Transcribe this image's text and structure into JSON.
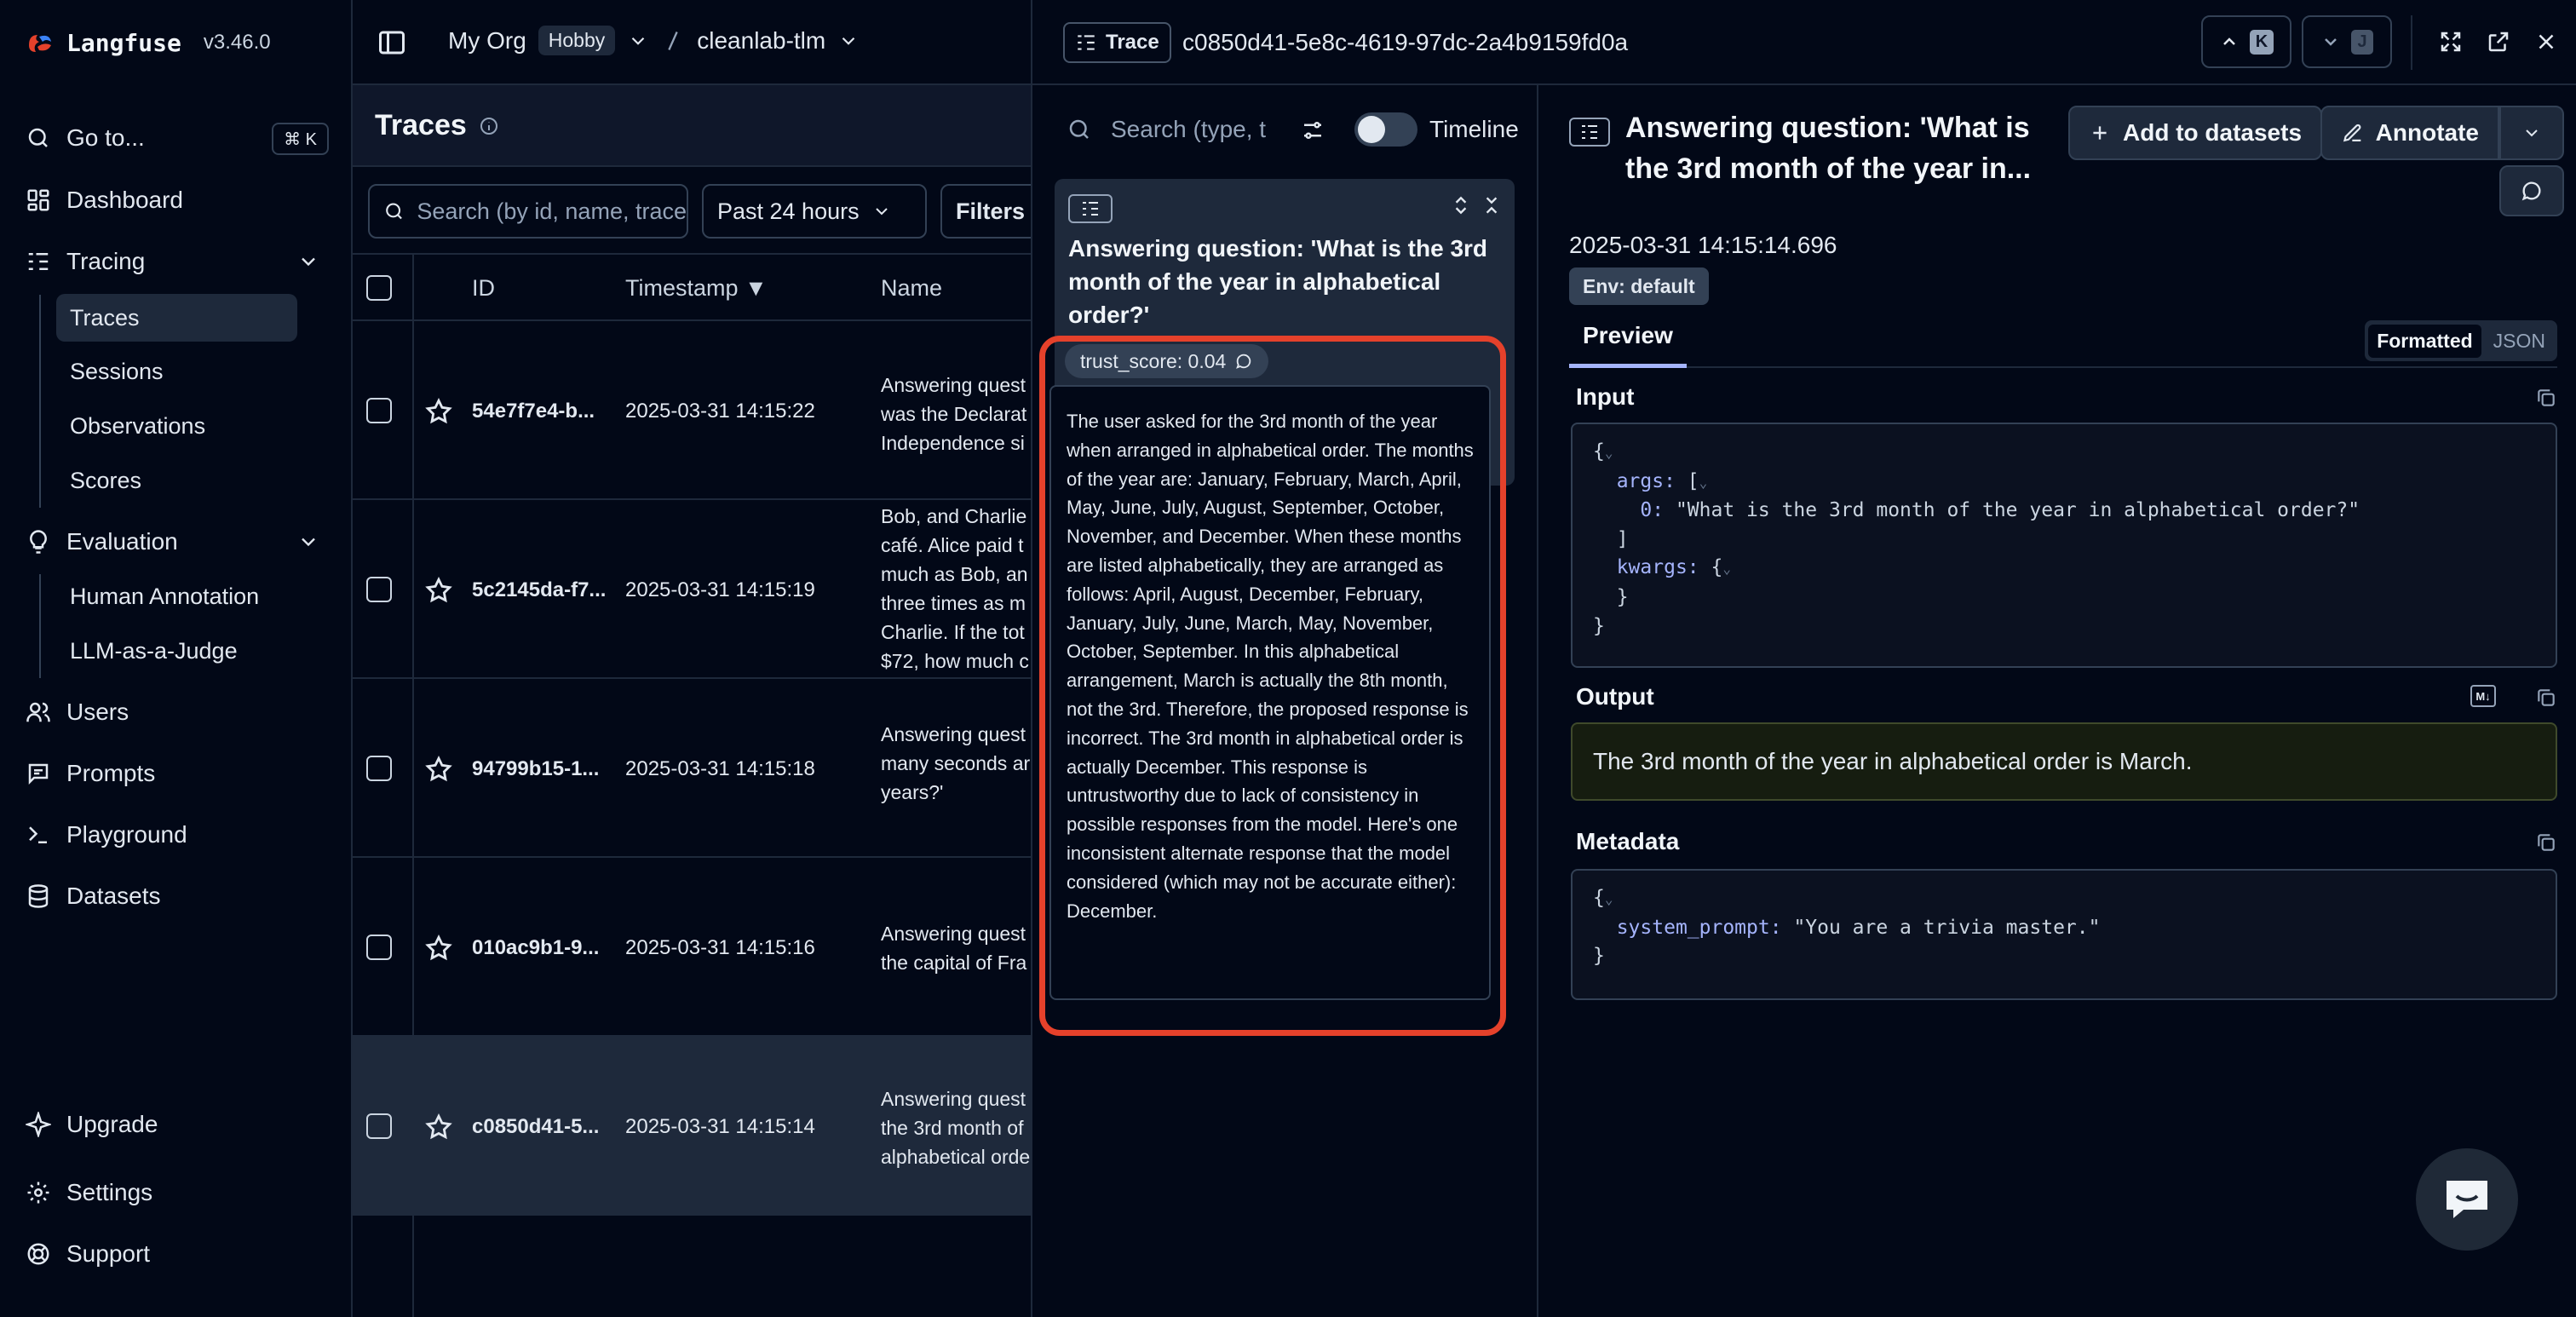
{
  "app": {
    "name": "Langfuse",
    "version": "v3.46.0"
  },
  "sidebar": {
    "goto": {
      "label": "Go to...",
      "shortcut": "⌘ K"
    },
    "items": [
      {
        "label": "Dashboard",
        "icon": "dashboard-icon"
      },
      {
        "label": "Tracing",
        "icon": "tracing-icon"
      },
      {
        "label": "Evaluation",
        "icon": "lightbulb-icon"
      },
      {
        "label": "Users",
        "icon": "users-icon"
      },
      {
        "label": "Prompts",
        "icon": "prompts-icon"
      },
      {
        "label": "Playground",
        "icon": "terminal-icon"
      },
      {
        "label": "Datasets",
        "icon": "database-icon"
      }
    ],
    "tracing_sub": [
      "Traces",
      "Sessions",
      "Observations",
      "Scores"
    ],
    "evaluation_sub": [
      "Human Annotation",
      "LLM-as-a-Judge"
    ],
    "bottom": [
      {
        "label": "Upgrade",
        "icon": "sparkle-icon"
      },
      {
        "label": "Settings",
        "icon": "settings-icon"
      },
      {
        "label": "Support",
        "icon": "lifebuoy-icon"
      }
    ]
  },
  "topbar": {
    "org": "My Org",
    "plan": "Hobby",
    "project": "cleanlab-tlm"
  },
  "traces": {
    "title": "Traces",
    "search_placeholder": "Search (by id, name, trace",
    "range": "Past 24 hours",
    "filters": "Filters",
    "columns": {
      "id": "ID",
      "timestamp": "Timestamp ▼",
      "name": "Name"
    },
    "rows": [
      {
        "id": "54e7f7e4-b...",
        "timestamp": "2025-03-31 14:15:22",
        "name": [
          "Answering quest",
          "was the Declarat",
          "Independence si"
        ]
      },
      {
        "id": "5c2145da-f7...",
        "timestamp": "2025-03-31 14:15:19",
        "name": [
          "Bob, and Charlie",
          "café. Alice paid t",
          "much as Bob, an",
          "three times as m",
          "Charlie. If the tot",
          "$72, how much c"
        ]
      },
      {
        "id": "94799b15-1...",
        "timestamp": "2025-03-31 14:15:18",
        "name": [
          "Answering quest",
          "many seconds ar",
          "years?'"
        ]
      },
      {
        "id": "010ac9b1-9...",
        "timestamp": "2025-03-31 14:15:16",
        "name": [
          "Answering quest",
          "the capital of Fra"
        ]
      },
      {
        "id": "c0850d41-5...",
        "timestamp": "2025-03-31 14:15:14",
        "name": [
          "Answering quest",
          "the 3rd month of",
          "alphabetical orde"
        ]
      }
    ]
  },
  "panel": {
    "tag": "Trace",
    "trace_id": "c0850d41-5e8c-4619-97dc-2a4b9159fd0a",
    "prev_key": "K",
    "next_key": "J",
    "tree": {
      "search_placeholder": "Search (type, t",
      "timeline_label": "Timeline",
      "node_title": "Answering question: 'What is the 3rd month of the year in alphabetical order?'",
      "score_label": "trust_score: 0.04",
      "explanation": "The user asked for the 3rd month of the year when arranged in alphabetical order. The months of the year are: January, February, March, April, May, June, July, August, September, October, November, and December. When these months are listed alphabetically, they are arranged as follows: April, August, December, February, January, July, June, March, May, November, October, September. In this alphabetical arrangement, March is actually the 8th month, not the 3rd. Therefore, the proposed response is incorrect. The 3rd month in alphabetical order is actually December. This response is untrustworthy due to lack of consistency in possible responses from the model. Here's one inconsistent alternate response that the model considered (which may not be accurate either): December."
    },
    "detail": {
      "title": "Answering question: 'What is the 3rd month of the year in...",
      "add_to_datasets": "Add to datasets",
      "annotate": "Annotate",
      "timestamp": "2025-03-31 14:15:14.696",
      "env": "Env: default",
      "tab": "Preview",
      "format_on": "Formatted",
      "format_off": "JSON",
      "input_label": "Input",
      "input": {
        "args_key": "args:",
        "arg0_key": "0:",
        "arg0_value": "\"What is the 3rd month of the year in alphabetical order?\"",
        "kwargs_key": "kwargs:"
      },
      "output_label": "Output",
      "output": "The 3rd month of the year in alphabetical order is March.",
      "metadata_label": "Metadata",
      "metadata": {
        "key": "system_prompt:",
        "value": "\"You are a trivia master.\""
      }
    }
  }
}
